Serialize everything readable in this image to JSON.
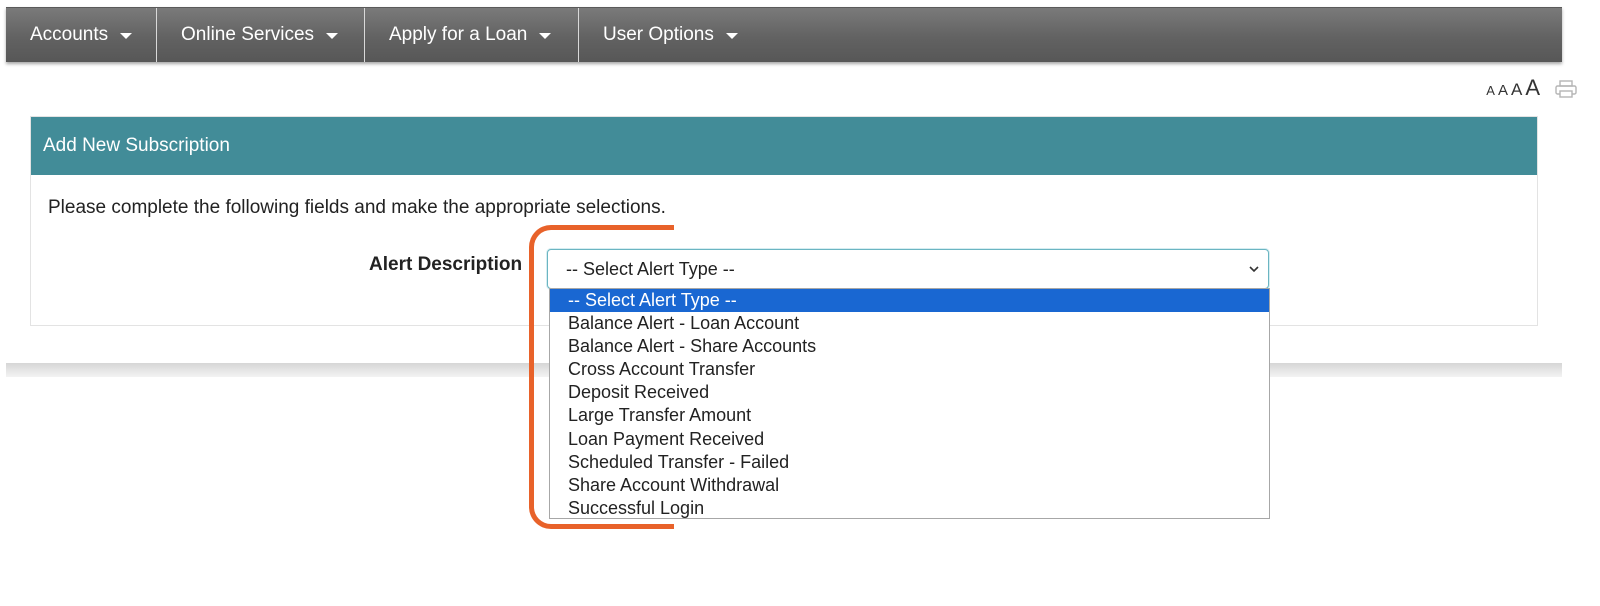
{
  "nav": {
    "items": [
      {
        "label": "Accounts"
      },
      {
        "label": "Online Services"
      },
      {
        "label": "Apply for a Loan"
      },
      {
        "label": "User Options"
      }
    ]
  },
  "text_tools": {
    "sizes": [
      "A",
      "A",
      "A",
      "A"
    ],
    "print_icon": "printer-icon"
  },
  "panel": {
    "title": "Add New Subscription",
    "instructions": "Please complete the following fields and make the appropriate selections."
  },
  "alert_field": {
    "label": "Alert Description",
    "selected": "-- Select Alert Type --",
    "options": [
      "-- Select Alert Type --",
      "Balance Alert - Loan Account",
      "Balance Alert - Share Accounts",
      "Cross Account Transfer",
      "Deposit Received",
      "Large Transfer Amount",
      "Loan Payment Received",
      "Scheduled Transfer - Failed",
      "Share Account Withdrawal",
      "Successful Login"
    ]
  },
  "colors": {
    "header_teal": "#428c98",
    "highlight_orange": "#e8622a",
    "selected_option": "#1967d2"
  }
}
